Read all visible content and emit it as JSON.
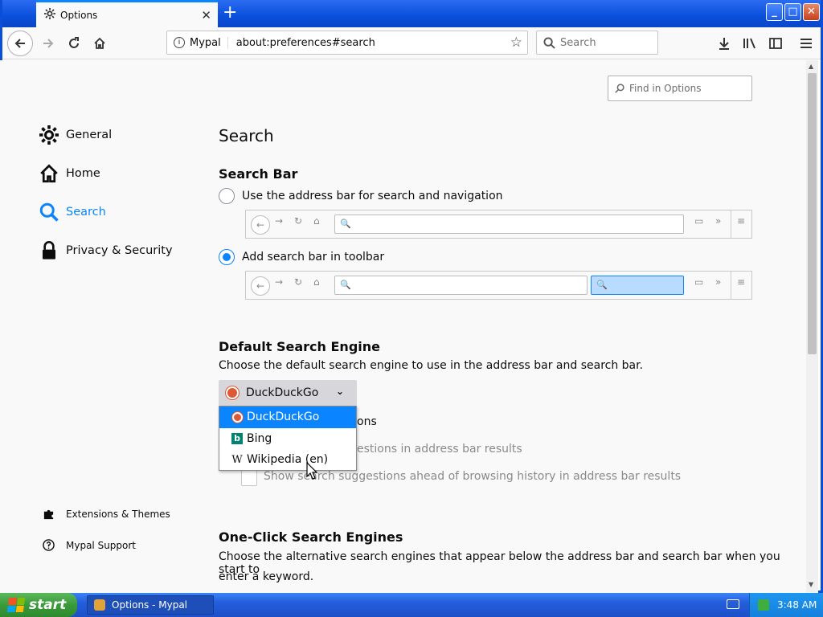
{
  "window": {
    "tab_title": "Options",
    "identity": "Mypal",
    "url": "about:preferences#search",
    "search_placeholder": "Search"
  },
  "page": {
    "find_placeholder": "Find in Options",
    "categories": [
      {
        "label": "General"
      },
      {
        "label": "Home"
      },
      {
        "label": "Search",
        "selected": true
      },
      {
        "label": "Privacy & Security"
      }
    ],
    "footer": [
      {
        "label": "Extensions & Themes"
      },
      {
        "label": "Mypal Support"
      }
    ],
    "title": "Search",
    "search_bar": {
      "heading": "Search Bar",
      "option_address_bar": "Use the address bar for search and navigation",
      "option_toolbar": "Add search bar in toolbar",
      "selected": "toolbar"
    },
    "default_engine": {
      "heading": "Default Search Engine",
      "description": "Choose the default search engine to use in the address bar and search bar.",
      "selected": "DuckDuckGo",
      "options": [
        "DuckDuckGo",
        "Bing",
        "Wikipedia (en)"
      ],
      "hidden_1": "ons",
      "hidden_2": "estions in address bar results",
      "suggestions_ahead": "Show search suggestions ahead of browsing history in address bar results"
    },
    "one_click": {
      "heading": "One-Click Search Engines",
      "description_line1": "Choose the alternative search engines that appear below the address bar and search bar when you start to",
      "description_line2": "enter a keyword."
    }
  },
  "taskbar": {
    "start_label": "start",
    "task_label": "Options - Mypal",
    "clock": "3:48 AM"
  },
  "colors": {
    "accent": "#0a84ff",
    "titlebar": "#0a4fdc",
    "taskbar": "#245edb",
    "start": "#3a9a3a"
  }
}
